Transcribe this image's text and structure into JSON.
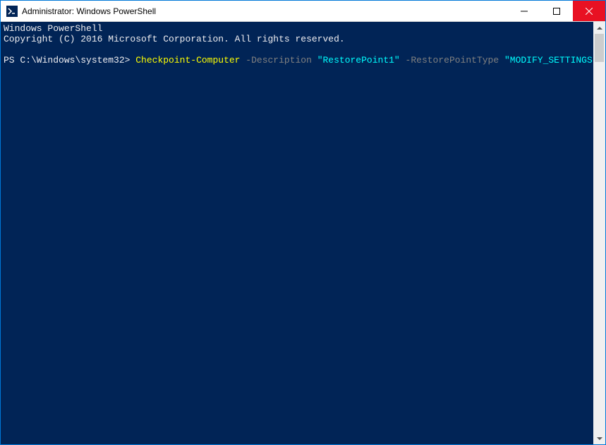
{
  "titlebar": {
    "title": "Administrator: Windows PowerShell"
  },
  "console": {
    "header_line1": "Windows PowerShell",
    "header_line2": "Copyright (C) 2016 Microsoft Corporation. All rights reserved.",
    "prompt_prefix": "PS ",
    "prompt_path": "C:\\Windows\\system32>",
    "space": " ",
    "cmdlet": "Checkpoint-Computer",
    "param1": " -Description ",
    "value1": "\"RestorePoint1\"",
    "param2": " -RestorePointType ",
    "value2": "\"MODIFY_SETTINGS\""
  }
}
